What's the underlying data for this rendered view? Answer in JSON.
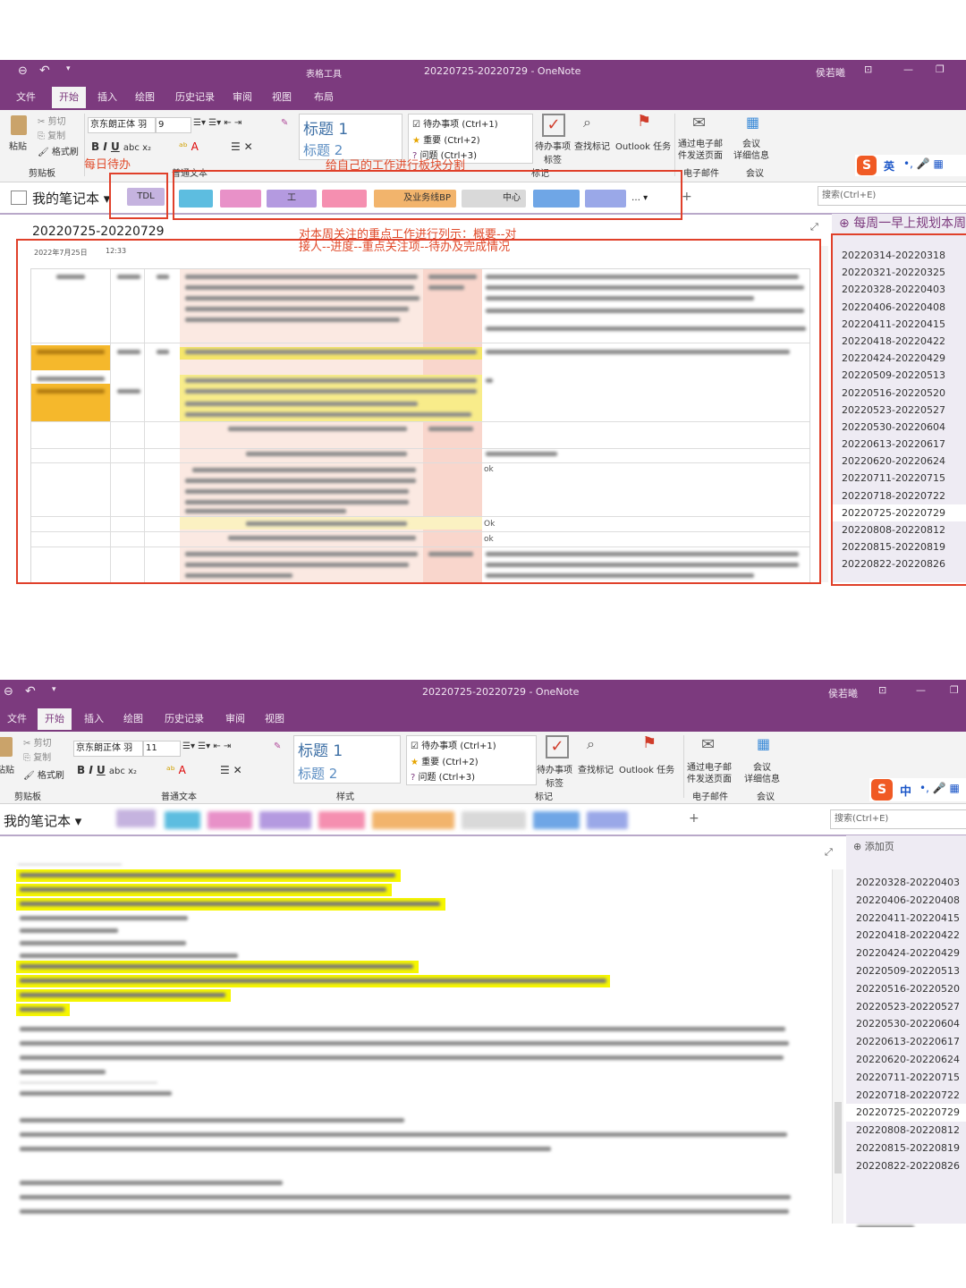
{
  "top": {
    "context_label": "表格工具",
    "window_title": "20220725-20220729 - OneNote",
    "user": "侯若曦",
    "tabs": [
      "文件",
      "开始",
      "插入",
      "绘图",
      "历史记录",
      "审阅",
      "视图",
      "布局"
    ],
    "font_name": "京东朗正体 羽",
    "font_size": "9",
    "clipboard": {
      "paste": "粘贴",
      "cut": "剪切",
      "copy": "复制",
      "format_painter": "格式刷",
      "group": "剪贴板"
    },
    "styles": [
      "标题 1",
      "标题 2"
    ],
    "tags": [
      "待办事项 (Ctrl+1)",
      "重要 (Ctrl+2)",
      "问题 (Ctrl+3)"
    ],
    "todo_tag": "待办事项\n标签",
    "find_tags": "查找标记",
    "outlook": "Outlook 任务",
    "email": "通过电子邮\n件发送页面",
    "email_group": "电子邮件",
    "meeting": "会议\n详细信息",
    "meeting_group": "会议",
    "normal_text_group": "普通文本",
    "tags_group": "标记",
    "notebook": "我的笔记本",
    "first_section": "TDL",
    "section_labels": [
      "工",
      "及业务线BP",
      "中心"
    ],
    "search_placeholder": "搜索(Ctrl+E)",
    "page_title": "20220725-20220729",
    "page_date": "2022年7月25日",
    "page_time": "12:33",
    "pages_header": "每周一早上规划本周",
    "pages": [
      "20220314-20220318",
      "20220321-20220325",
      "20220328-20220403",
      "20220406-20220408",
      "20220411-20220415",
      "20220418-20220422",
      "20220424-20220429",
      "20220509-20220513",
      "20220516-20220520",
      "20220523-20220527",
      "20220530-20220604",
      "20220613-20220617",
      "20220620-20220624",
      "20220711-20220715",
      "20220718-20220722",
      "20220725-20220729",
      "20220808-20220812",
      "20220815-20220819",
      "20220822-20220826"
    ],
    "cell_ok": [
      "ok",
      "Ok",
      "ok"
    ],
    "annotations": {
      "daily": "每日待办",
      "sections": "给自己的工作进行板块分割",
      "focus": "对本周关注的重点工作进行列示：概要--对接人--进度--重点关注项--待办及完成情况"
    }
  },
  "bottom": {
    "window_title": "20220725-20220729 - OneNote",
    "user": "侯若曦",
    "tabs": [
      "文件",
      "开始",
      "插入",
      "绘图",
      "历史记录",
      "审阅",
      "视图"
    ],
    "font_name": "京东朗正体 羽",
    "font_size": "11",
    "styles": [
      "标题 1",
      "标题 2"
    ],
    "styles_group": "样式",
    "tags": [
      "待办事项 (Ctrl+1)",
      "重要 (Ctrl+2)",
      "问题 (Ctrl+3)"
    ],
    "ime": "中",
    "add_page": "添加页",
    "search_placeholder": "搜索(Ctrl+E)",
    "pages": [
      "20220328-20220403",
      "20220406-20220408",
      "20220411-20220415",
      "20220418-20220422",
      "20220424-20220429",
      "20220509-20220513",
      "20220516-20220520",
      "20220523-20220527",
      "20220530-20220604",
      "20220613-20220617",
      "20220620-20220624",
      "20220711-20220715",
      "20220718-20220722",
      "20220725-20220729",
      "20220808-20220812",
      "20220815-20220819",
      "20220822-20220826"
    ]
  },
  "ime_top": "英",
  "colors": {
    "accent": "#7c3a7e",
    "annotation": "#e0402a",
    "highlight": "#f6f600"
  }
}
